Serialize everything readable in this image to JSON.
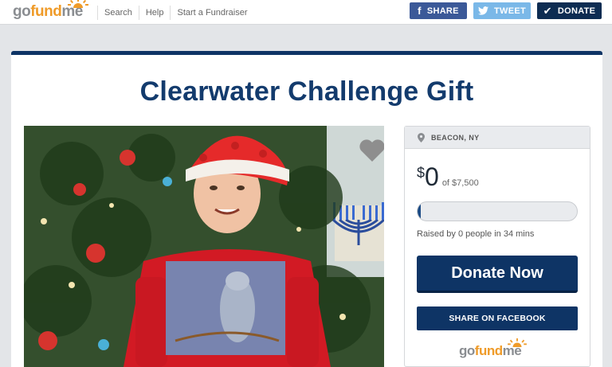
{
  "header": {
    "logo_go": "go",
    "logo_fund": "fund",
    "logo_me": "me",
    "nav": [
      "Search",
      "Help",
      "Start a Fundraiser"
    ],
    "share_label": "SHARE",
    "tweet_label": "TWEET",
    "donate_label": "DONATE"
  },
  "campaign": {
    "title": "Clearwater Challenge Gift",
    "location": "BEACON, NY",
    "currency": "$",
    "raised": "0",
    "goal_text": "of $7,500",
    "progress_fraction": 0.02,
    "raised_by": "Raised by 0 people in 34 mins",
    "donate_now_label": "Donate Now",
    "share_facebook_label": "SHARE ON FACEBOOK"
  },
  "icons": {
    "share": "facebook-icon",
    "tweet": "twitter-icon",
    "donate": "checkmark-icon",
    "favorite": "heart-icon",
    "location": "map-pin-icon"
  },
  "colors": {
    "navy": "#0e3465",
    "facebook": "#3b5998",
    "twitter": "#7ab8e8",
    "orange": "#ef9b29"
  }
}
